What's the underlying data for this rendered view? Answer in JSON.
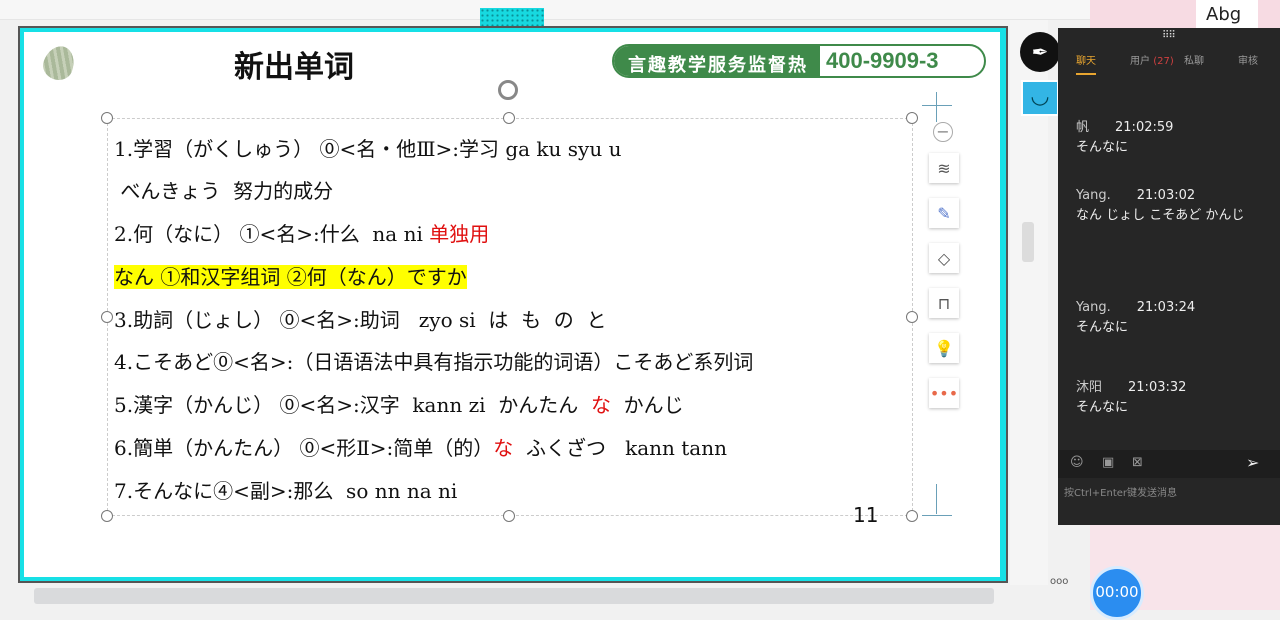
{
  "slide": {
    "title": "新出单词",
    "hotline_label": "言趣教学服务监督热线",
    "hotline_number": "400-9909-3",
    "page_number": "11",
    "lines": [
      [
        {
          "t": "1.学習（がくしゅう） ⓪<名・他Ⅲ>:学习 ga ku syu u"
        }
      ],
      [
        {
          "t": " べんきょう  努力的成分"
        }
      ],
      [
        {
          "t": "2.何（なに） ①<名>:什么  na ni "
        },
        {
          "t": "单独用",
          "red": true
        }
      ],
      [
        {
          "t": "なん ①和汉字组词 ②何（なん）ですか",
          "hl": true
        }
      ],
      [
        {
          "t": "3.助詞（じょし） ⓪<名>:助词   zyo si  は  も  の  と"
        }
      ],
      [
        {
          "t": "4.こそあど⓪<名>:（日语语法中具有指示功能的词语）こそあど系列词"
        }
      ],
      [
        {
          "t": "5.漢字（かんじ） ⓪<名>:汉字  kann zi  かんたん  "
        },
        {
          "t": "な",
          "red": true
        },
        {
          "t": "  かんじ"
        }
      ],
      [
        {
          "t": "6.簡単（かんたん） ⓪<形Ⅱ>:简单（的）"
        },
        {
          "t": "な",
          "red": true
        },
        {
          "t": "  ふくざつ   kann tann"
        }
      ],
      [
        {
          "t": "7.そんなに④<副>:那么  so nn na ni"
        }
      ]
    ]
  },
  "chat": {
    "tabs": {
      "chat": "聊天",
      "users": "用户",
      "user_count": "(27)",
      "private": "私聊",
      "review": "审核"
    },
    "messages": [
      {
        "user": "帆",
        "time": "21:02:59",
        "text": "そんなに"
      },
      {
        "user": "Yang.",
        "time": "21:03:02",
        "text": "なん じょし こそあど かんじ"
      },
      {
        "user": "Yang.",
        "time": "21:03:24",
        "text": "そんなに"
      },
      {
        "user": "沐阳",
        "time": "21:03:32",
        "text": "そんなに"
      }
    ],
    "input_placeholder": "按Ctrl+Enter键发送消息"
  },
  "corner_text": "Abg",
  "timer": "00:00",
  "more_label": "ooo",
  "colors": {
    "accent": "#17e0e6",
    "hotline": "#3f8a4a",
    "chat_bg": "#262626",
    "tab_active": "#e8a530"
  }
}
